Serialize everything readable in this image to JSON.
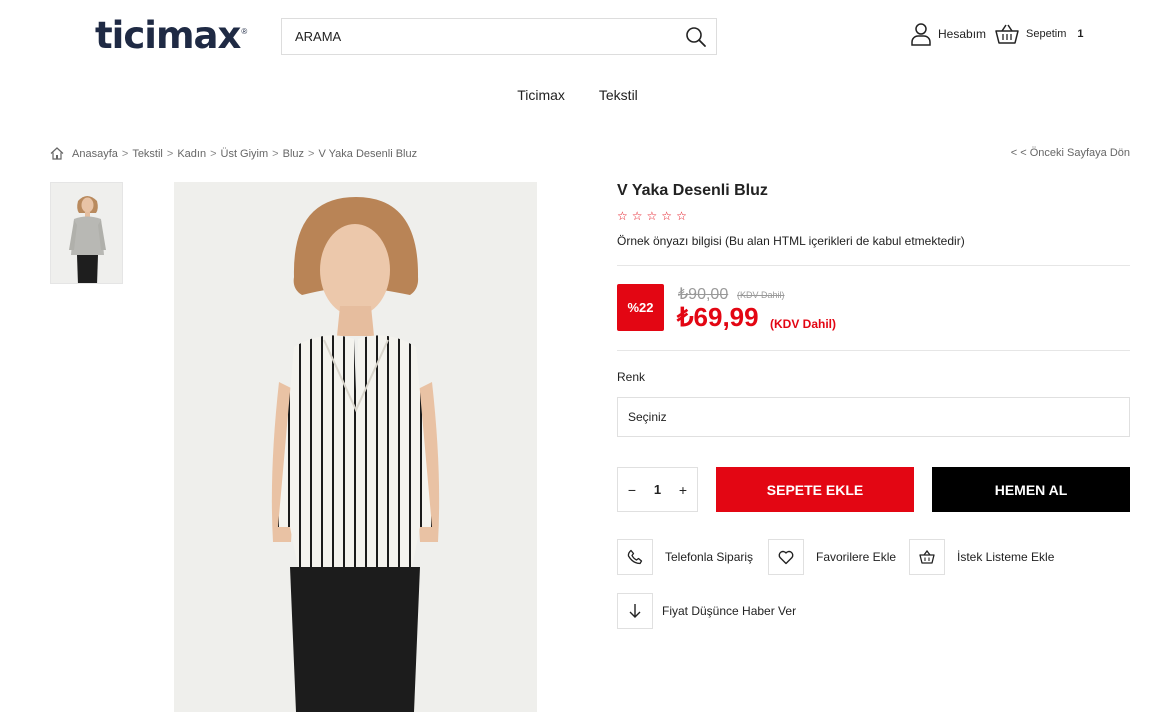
{
  "header": {
    "logo": "ticimax",
    "logo_mark": "®",
    "search": {
      "placeholder": "ARAMA"
    },
    "account_label": "Hesabım",
    "cart_label": "Sepetim",
    "cart_count": "1"
  },
  "nav": [
    "Ticimax",
    "Tekstil"
  ],
  "breadcrumb": {
    "items": [
      "Anasayfa",
      "Tekstil",
      "Kadın",
      "Üst Giyim",
      "Bluz",
      "V Yaka Desenli Bluz"
    ],
    "separator": ">",
    "back": "< < Önceki Sayfaya Dön"
  },
  "product": {
    "title": "V Yaka Desenli Bluz",
    "rating": 0,
    "stars": [
      "☆",
      "☆",
      "☆",
      "☆",
      "☆"
    ],
    "short_desc": "Örnek önyazı bilgisi (Bu alan HTML içerikleri de kabul etmektedir)",
    "discount": "%22",
    "old_price": "₺90,00",
    "old_price_note": "(KDV Dahil)",
    "new_price": "₺69,99",
    "new_price_note": "(KDV Dahil)",
    "variant_label": "Renk",
    "variant_selected": "Seçiniz",
    "quantity": {
      "minus": "−",
      "value": "1",
      "plus": "+"
    },
    "add_to_cart": "SEPETE EKLE",
    "buy_now": "HEMEN AL",
    "actions": {
      "phone": "Telefonla Sipariş",
      "favorite": "Favorilere Ekle",
      "wishlist": "İstek Listeme Ekle",
      "price_alert": "Fiyat Düşünce Haber Ver"
    }
  },
  "icons": [
    "search-icon",
    "user-icon",
    "basket-icon",
    "home-icon",
    "phone-icon",
    "heart-icon",
    "basket-icon",
    "arrow-down-icon"
  ],
  "colors": {
    "accent": "#e30613",
    "dark": "#000000",
    "logo": "#1f2a44",
    "border": "#e0e0e0"
  }
}
